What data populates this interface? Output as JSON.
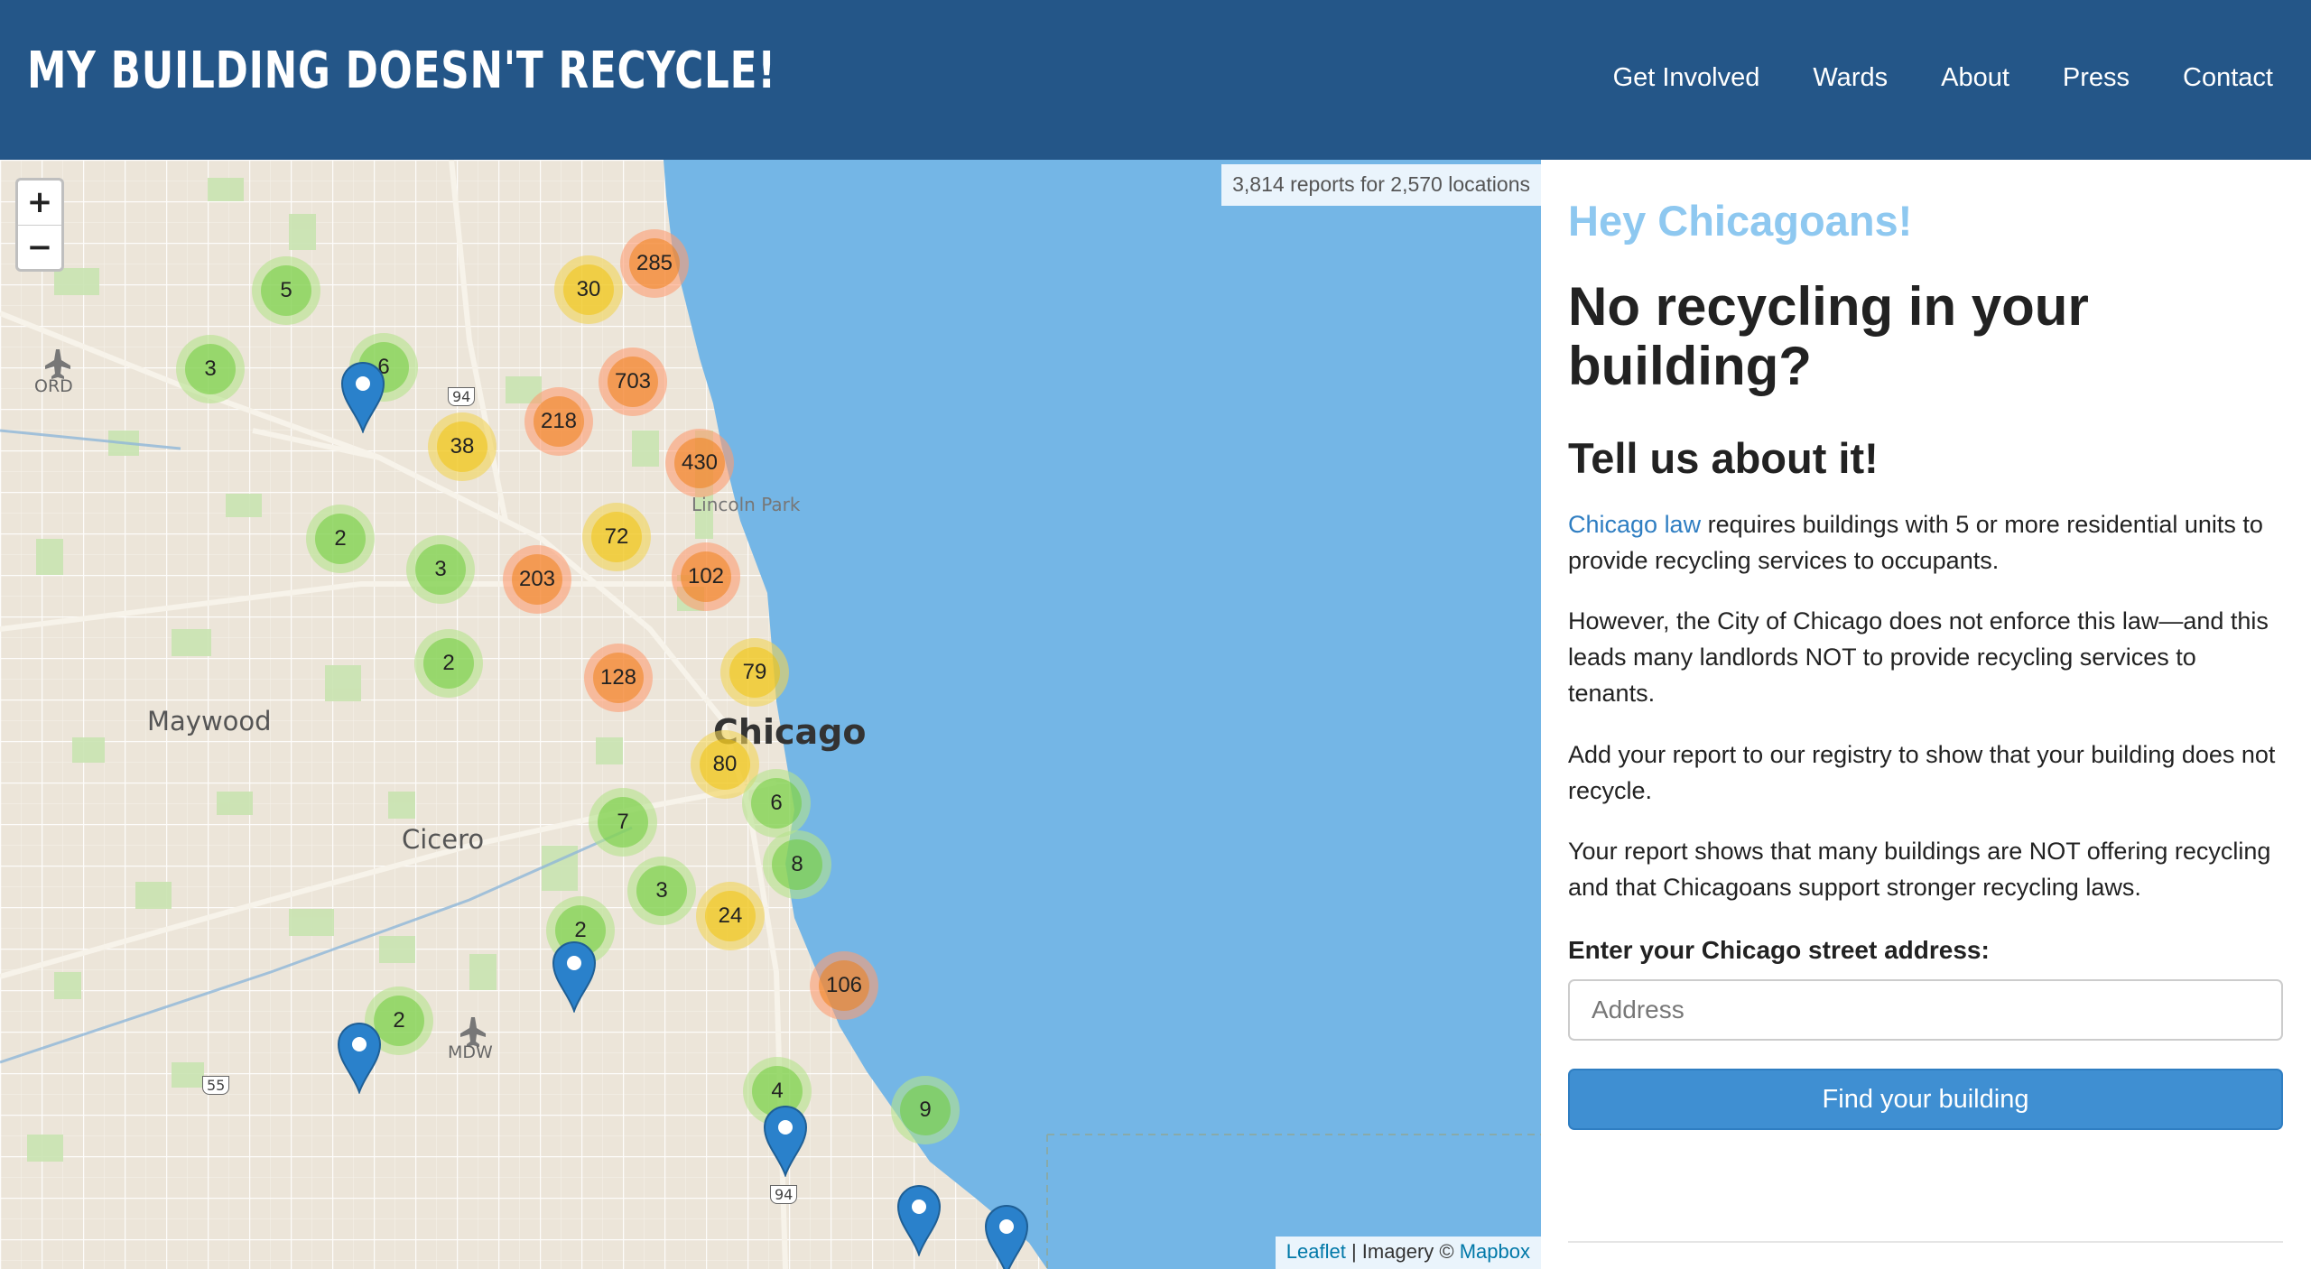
{
  "header": {
    "brand": "MY BUILDING DOESN'T RECYCLE!",
    "nav": [
      "Get Involved",
      "Wards",
      "About",
      "Press",
      "Contact"
    ]
  },
  "map": {
    "zoom_in": "+",
    "zoom_out": "−",
    "report_summary": "3,814 reports for 2,570 locations",
    "attribution": {
      "leaflet": "Leaflet",
      "separator": " | Imagery © ",
      "mapbox": "Mapbox"
    },
    "places": [
      "Chicago",
      "Maywood",
      "Cicero",
      "Lincoln Park",
      "ORD",
      "MDW"
    ],
    "highways": [
      "94",
      "55",
      "94"
    ],
    "clusters": [
      "5",
      "3",
      "6",
      "30",
      "285",
      "703",
      "218",
      "38",
      "430",
      "2",
      "3",
      "72",
      "203",
      "102",
      "2",
      "128",
      "79",
      "80",
      "6",
      "7",
      "8",
      "3",
      "24",
      "2",
      "106",
      "2",
      "4",
      "9"
    ],
    "colors": {
      "green": "#6ecc39",
      "yellow": "#f0c20c",
      "orange": "#f18017",
      "water": "#74b6e6",
      "land": "#ece5d9",
      "pin": "#2a81cb"
    }
  },
  "sidebar": {
    "greeting": "Hey Chicagoans!",
    "headline": "No recycling in your building?",
    "subhead": "Tell us about it!",
    "p1_link": "Chicago law",
    "p1_rest": " requires buildings with 5 or more residential units to provide recycling services to occupants.",
    "p2": "However, the City of Chicago does not enforce this law—and this leads many landlords NOT to provide recycling services to tenants.",
    "p3": "Add your report to our registry to show that your building does not recycle.",
    "p4": "Your report shows that many buildings are NOT offering recycling and that Chicagoans support stronger recycling laws.",
    "address_label": "Enter your Chicago street address:",
    "address_placeholder": "Address",
    "find_button": "Find your building"
  }
}
